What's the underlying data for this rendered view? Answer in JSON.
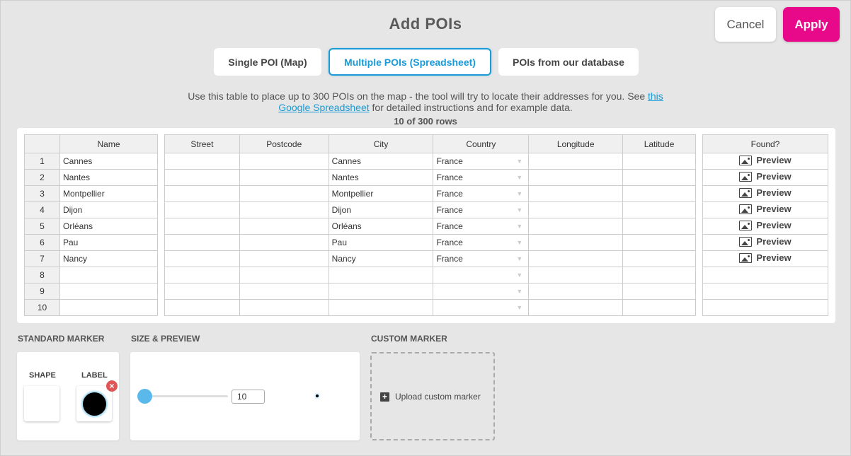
{
  "dialog": {
    "title": "Add POIs",
    "cancel_label": "Cancel",
    "apply_label": "Apply",
    "accent_color": "#e8088a"
  },
  "tabs": [
    {
      "label": "Single POI (Map)",
      "active": false
    },
    {
      "label": "Multiple POIs (Spreadsheet)",
      "active": true
    },
    {
      "label": "POIs from our database",
      "active": false
    }
  ],
  "instructions": {
    "text_before": "Use this table to place up to 300 POIs on the map - the tool will try to locate their addresses for you. See ",
    "link_text": "this Google Spreadsheet",
    "text_after": " for detailed instructions and for example data.",
    "row_count": "10 of 300 rows"
  },
  "table": {
    "headers": {
      "name": "Name",
      "street": "Street",
      "postcode": "Postcode",
      "city": "City",
      "country": "Country",
      "longitude": "Longitude",
      "latitude": "Latitude",
      "found": "Found?"
    },
    "rows": [
      {
        "num": "1",
        "name": "Cannes",
        "street": "",
        "postcode": "",
        "city": "Cannes",
        "country": "France",
        "longitude": "",
        "latitude": "",
        "found": "Preview"
      },
      {
        "num": "2",
        "name": "Nantes",
        "street": "",
        "postcode": "",
        "city": "Nantes",
        "country": "France",
        "longitude": "",
        "latitude": "",
        "found": "Preview"
      },
      {
        "num": "3",
        "name": "Montpellier",
        "street": "",
        "postcode": "",
        "city": "Montpellier",
        "country": "France",
        "longitude": "",
        "latitude": "",
        "found": "Preview"
      },
      {
        "num": "4",
        "name": "Dijon",
        "street": "",
        "postcode": "",
        "city": "Dijon",
        "country": "France",
        "longitude": "",
        "latitude": "",
        "found": "Preview"
      },
      {
        "num": "5",
        "name": "Orléans",
        "street": "",
        "postcode": "",
        "city": "Orléans",
        "country": "France",
        "longitude": "",
        "latitude": "",
        "found": "Preview"
      },
      {
        "num": "6",
        "name": "Pau",
        "street": "",
        "postcode": "",
        "city": "Pau",
        "country": "France",
        "longitude": "",
        "latitude": "",
        "found": "Preview"
      },
      {
        "num": "7",
        "name": "Nancy",
        "street": "",
        "postcode": "",
        "city": "Nancy",
        "country": "France",
        "longitude": "",
        "latitude": "",
        "found": "Preview"
      },
      {
        "num": "8",
        "name": "",
        "street": "",
        "postcode": "",
        "city": "",
        "country": "",
        "longitude": "",
        "latitude": "",
        "found": ""
      },
      {
        "num": "9",
        "name": "",
        "street": "",
        "postcode": "",
        "city": "",
        "country": "",
        "longitude": "",
        "latitude": "",
        "found": ""
      },
      {
        "num": "10",
        "name": "",
        "street": "",
        "postcode": "",
        "city": "",
        "country": "",
        "longitude": "",
        "latitude": "",
        "found": ""
      }
    ]
  },
  "standard_marker": {
    "section_label": "STANDARD MARKER",
    "shape_label": "SHAPE",
    "label_label": "LABEL",
    "label_color": "#000000",
    "remove_icon": "close-icon"
  },
  "size_preview": {
    "section_label": "SIZE & PREVIEW",
    "size_value": "10",
    "slider_fraction": 0.05,
    "slider_color": "#5bb8ea"
  },
  "custom_marker": {
    "section_label": "CUSTOM MARKER",
    "upload_label": "Upload custom marker",
    "upload_icon": "plus-icon"
  }
}
